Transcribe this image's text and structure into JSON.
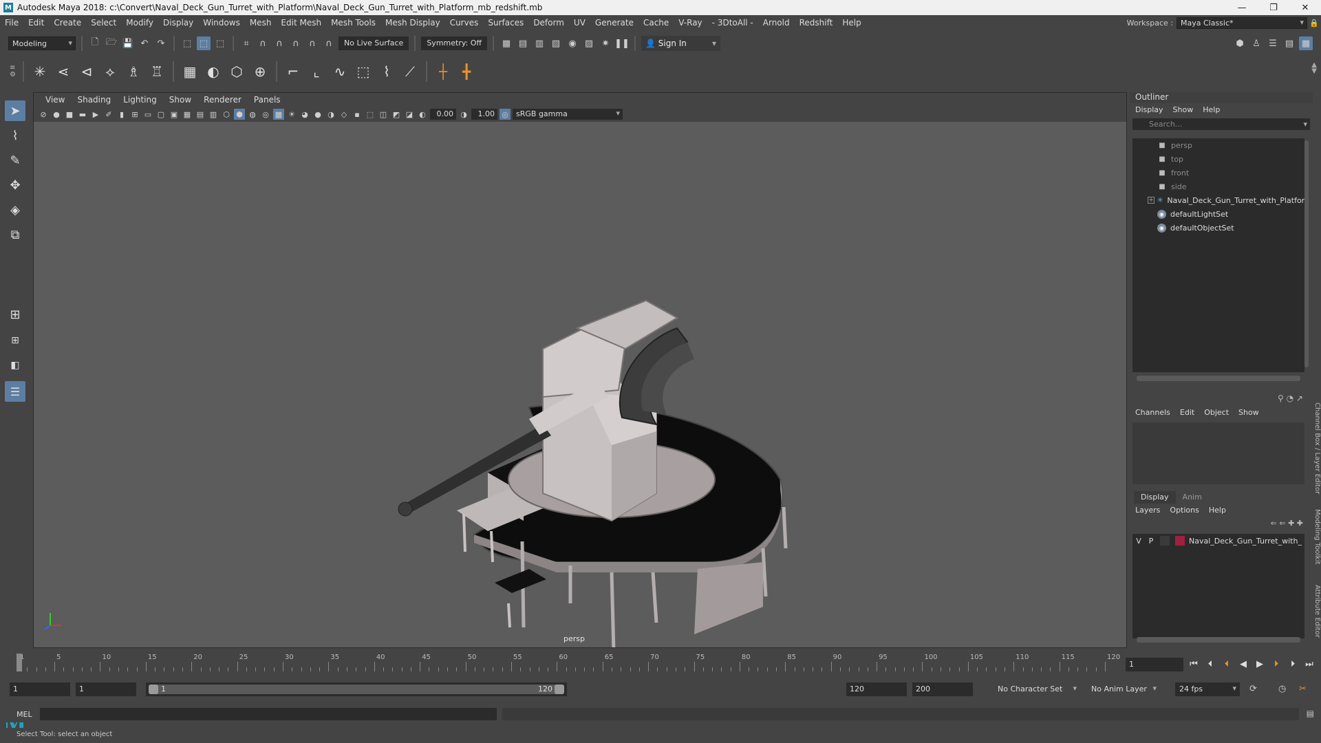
{
  "window": {
    "app_icon": "M",
    "title": "Autodesk Maya 2018: c:\\Convert\\Naval_Deck_Gun_Turret_with_Platform\\Naval_Deck_Gun_Turret_with_Platform_mb_redshift.mb",
    "minimize": "—",
    "maximize": "❐",
    "close": "✕"
  },
  "menubar": {
    "items": [
      "File",
      "Edit",
      "Create",
      "Select",
      "Modify",
      "Display",
      "Windows",
      "Mesh",
      "Edit Mesh",
      "Mesh Tools",
      "Mesh Display",
      "Curves",
      "Surfaces",
      "Deform",
      "UV",
      "Generate",
      "Cache",
      "V-Ray",
      "- 3DtoAll -",
      "Arnold",
      "Redshift",
      "Help"
    ],
    "workspace_label": "Workspace :",
    "workspace_value": "Maya Classic*"
  },
  "statusline": {
    "mode": "Modeling",
    "live_surface": "No Live Surface",
    "symmetry": "Symmetry: Off",
    "sign_in": "Sign In"
  },
  "viewport": {
    "menu": [
      "View",
      "Shading",
      "Lighting",
      "Show",
      "Renderer",
      "Panels"
    ],
    "exposure": "0.00",
    "gamma": "1.00",
    "color_space": "sRGB gamma",
    "camera": "persp"
  },
  "outliner": {
    "title": "Outliner",
    "menu": [
      "Display",
      "Show",
      "Help"
    ],
    "search_placeholder": "Search...",
    "items": [
      {
        "label": "persp",
        "type": "camera"
      },
      {
        "label": "top",
        "type": "camera"
      },
      {
        "label": "front",
        "type": "camera"
      },
      {
        "label": "side",
        "type": "camera"
      },
      {
        "label": "Naval_Deck_Gun_Turret_with_Platform_r",
        "type": "group"
      },
      {
        "label": "defaultLightSet",
        "type": "set"
      },
      {
        "label": "defaultObjectSet",
        "type": "set"
      }
    ]
  },
  "channelbox": {
    "menu": [
      "Channels",
      "Edit",
      "Object",
      "Show"
    ]
  },
  "layereditor": {
    "tabs": [
      "Display",
      "Anim"
    ],
    "menu": [
      "Layers",
      "Options",
      "Help"
    ],
    "layer": {
      "v": "V",
      "p": "P",
      "name": "Naval_Deck_Gun_Turret_with_",
      "color": "#a02040"
    }
  },
  "side_tabs": [
    "Channel Box / Layer Editor",
    "Modeling Toolkit",
    "Attribute Editor"
  ],
  "timeline": {
    "ticks": [
      "1",
      "5",
      "10",
      "15",
      "20",
      "25",
      "30",
      "35",
      "40",
      "45",
      "50",
      "55",
      "60",
      "65",
      "70",
      "75",
      "80",
      "85",
      "90",
      "95",
      "100",
      "105",
      "110",
      "115",
      "120"
    ],
    "current_frame": "1"
  },
  "range": {
    "start": "1",
    "playback_start": "1",
    "slider_start": "1",
    "slider_end": "120",
    "playback_end": "120",
    "end": "200",
    "character_set": "No Character Set",
    "anim_layer": "No Anim Layer",
    "fps": "24 fps"
  },
  "command": {
    "label": "MEL"
  },
  "help_line": "Select Tool: select an object"
}
